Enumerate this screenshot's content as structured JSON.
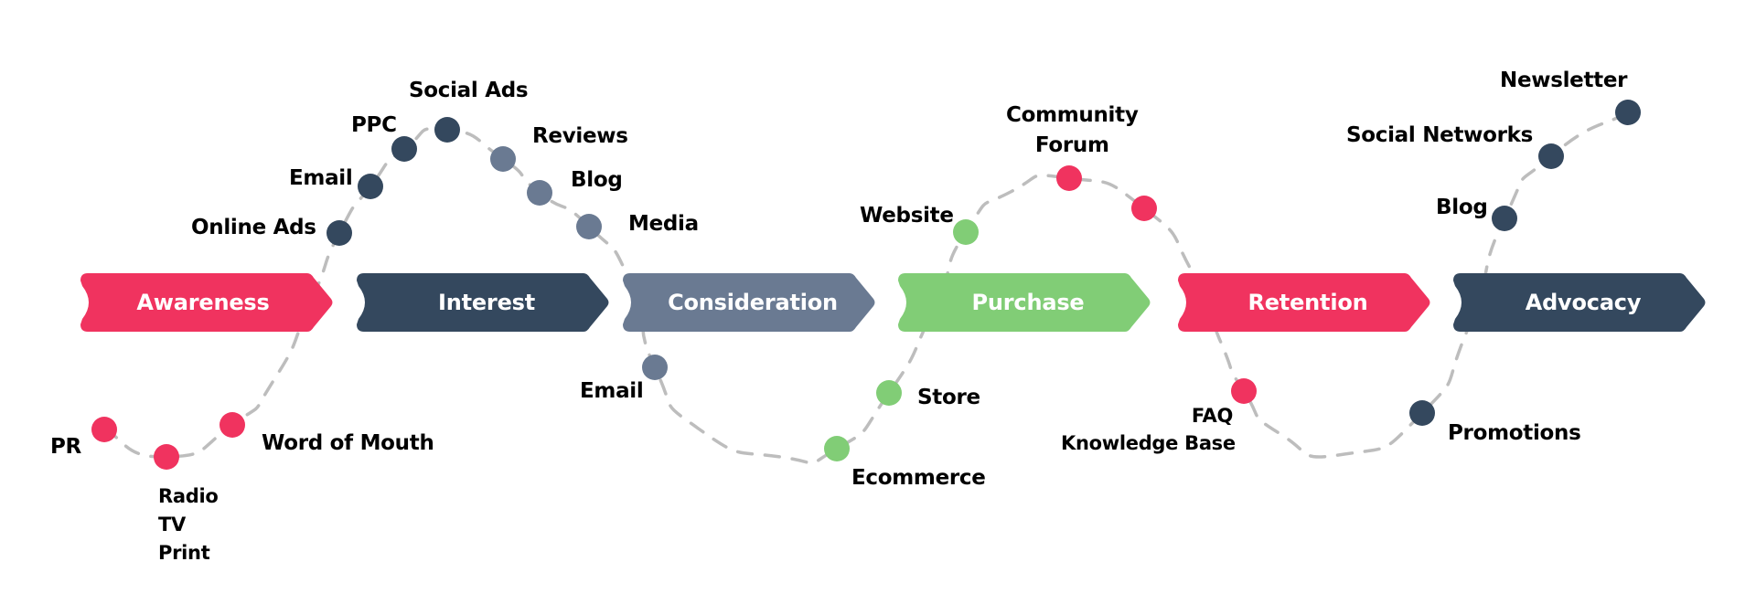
{
  "colors": {
    "pink": "#f0335f",
    "navy": "#34485e",
    "slate": "#6a7a92",
    "green": "#81cd76",
    "dash": "#bdbdbd"
  },
  "stages": [
    {
      "label": "Awareness",
      "color": "pink"
    },
    {
      "label": "Interest",
      "color": "navy"
    },
    {
      "label": "Consideration",
      "color": "slate"
    },
    {
      "label": "Purchase",
      "color": "green"
    },
    {
      "label": "Retention",
      "color": "pink"
    },
    {
      "label": "Advocacy",
      "color": "navy"
    }
  ],
  "touchpoints": [
    {
      "stage": "Awareness",
      "label": "PR",
      "color": "pink"
    },
    {
      "stage": "Awareness",
      "label": "Radio\nTV\nPrint",
      "color": "pink"
    },
    {
      "stage": "Awareness",
      "label": "Word of Mouth",
      "color": "pink"
    },
    {
      "stage": "Interest",
      "label": "Online Ads",
      "color": "navy"
    },
    {
      "stage": "Interest",
      "label": "Email",
      "color": "navy"
    },
    {
      "stage": "Interest",
      "label": "PPC",
      "color": "navy"
    },
    {
      "stage": "Interest",
      "label": "Social Ads",
      "color": "navy"
    },
    {
      "stage": "Consideration",
      "label": "Reviews",
      "color": "slate"
    },
    {
      "stage": "Consideration",
      "label": "Blog",
      "color": "slate"
    },
    {
      "stage": "Consideration",
      "label": "Media",
      "color": "slate"
    },
    {
      "stage": "Consideration",
      "label": "Email",
      "color": "slate"
    },
    {
      "stage": "Purchase",
      "label": "Ecommerce",
      "color": "green"
    },
    {
      "stage": "Purchase",
      "label": "Store",
      "color": "green"
    },
    {
      "stage": "Purchase",
      "label": "Website",
      "color": "green"
    },
    {
      "stage": "Retention",
      "label": "Community\nForum",
      "color": "pink"
    },
    {
      "stage": "Retention",
      "label": "",
      "color": "pink"
    },
    {
      "stage": "Retention",
      "label": "FAQ\nKnowledge Base",
      "color": "pink"
    },
    {
      "stage": "Advocacy",
      "label": "Promotions",
      "color": "navy"
    },
    {
      "stage": "Advocacy",
      "label": "Blog",
      "color": "navy"
    },
    {
      "stage": "Advocacy",
      "label": "Social Networks",
      "color": "navy"
    },
    {
      "stage": "Advocacy",
      "label": "Newsletter",
      "color": "navy"
    }
  ]
}
